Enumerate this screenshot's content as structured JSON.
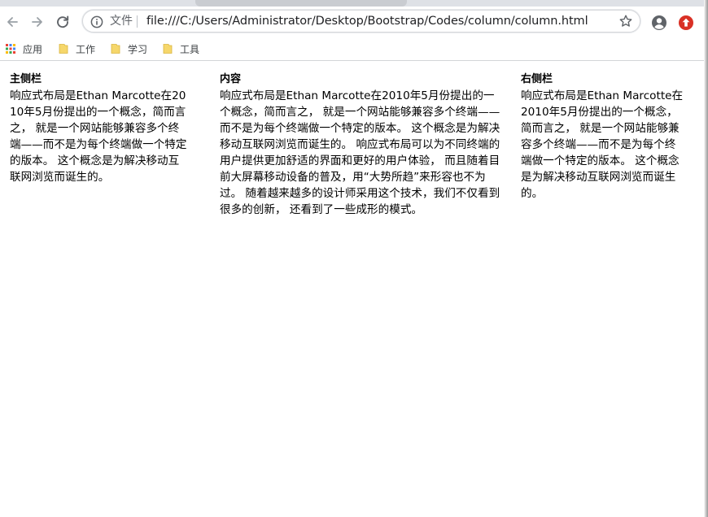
{
  "browser": {
    "nav": {
      "back_icon": "arrow-left-icon",
      "forward_icon": "arrow-right-icon",
      "reload_icon": "reload-icon"
    },
    "omnibox": {
      "scheme_label": "文件",
      "url": "file:///C:/Users/Administrator/Desktop/Bootstrap/Codes/column/column.html",
      "info_icon": "info-icon",
      "star_icon": "star-icon"
    },
    "profile_icon": "account-circle-icon",
    "extension_icon": "extension-icon",
    "colors": {
      "extension": "#d93025",
      "icon_gray": "#5f6368",
      "folder": "#f6d76b"
    }
  },
  "bookmarks": [
    {
      "label": "应用",
      "icon": "apps-grid-icon"
    },
    {
      "label": "工作",
      "icon": "folder-icon"
    },
    {
      "label": "学习",
      "icon": "folder-icon"
    },
    {
      "label": "工具",
      "icon": "folder-icon"
    }
  ],
  "page": {
    "columns": [
      {
        "title": "主侧栏",
        "text": "响应式布局是Ethan Marcotte在2010年5月份提出的一个概念，简而言之， 就是一个网站能够兼容多个终端——而不是为每个终端做一个特定的版本。 这个概念是为解决移动互联网浏览而诞生的。"
      },
      {
        "title": "内容",
        "text": "响应式布局是Ethan Marcotte在2010年5月份提出的一个概念，简而言之， 就是一个网站能够兼容多个终端——而不是为每个终端做一个特定的版本。 这个概念是为解决移动互联网浏览而诞生的。 响应式布局可以为不同终端的用户提供更加舒适的界面和更好的用户体验， 而且随着目前大屏幕移动设备的普及，用“大势所趋”来形容也不为过。 随着越来越多的设计师采用这个技术，我们不仅看到很多的创新， 还看到了一些成形的模式。"
      },
      {
        "title": "右侧栏",
        "text": "响应式布局是Ethan Marcotte在2010年5月份提出的一个概念，简而言之， 就是一个网站能够兼容多个终端——而不是为每个终端做一个特定的版本。 这个概念是为解决移动互联网浏览而诞生的。"
      }
    ]
  }
}
